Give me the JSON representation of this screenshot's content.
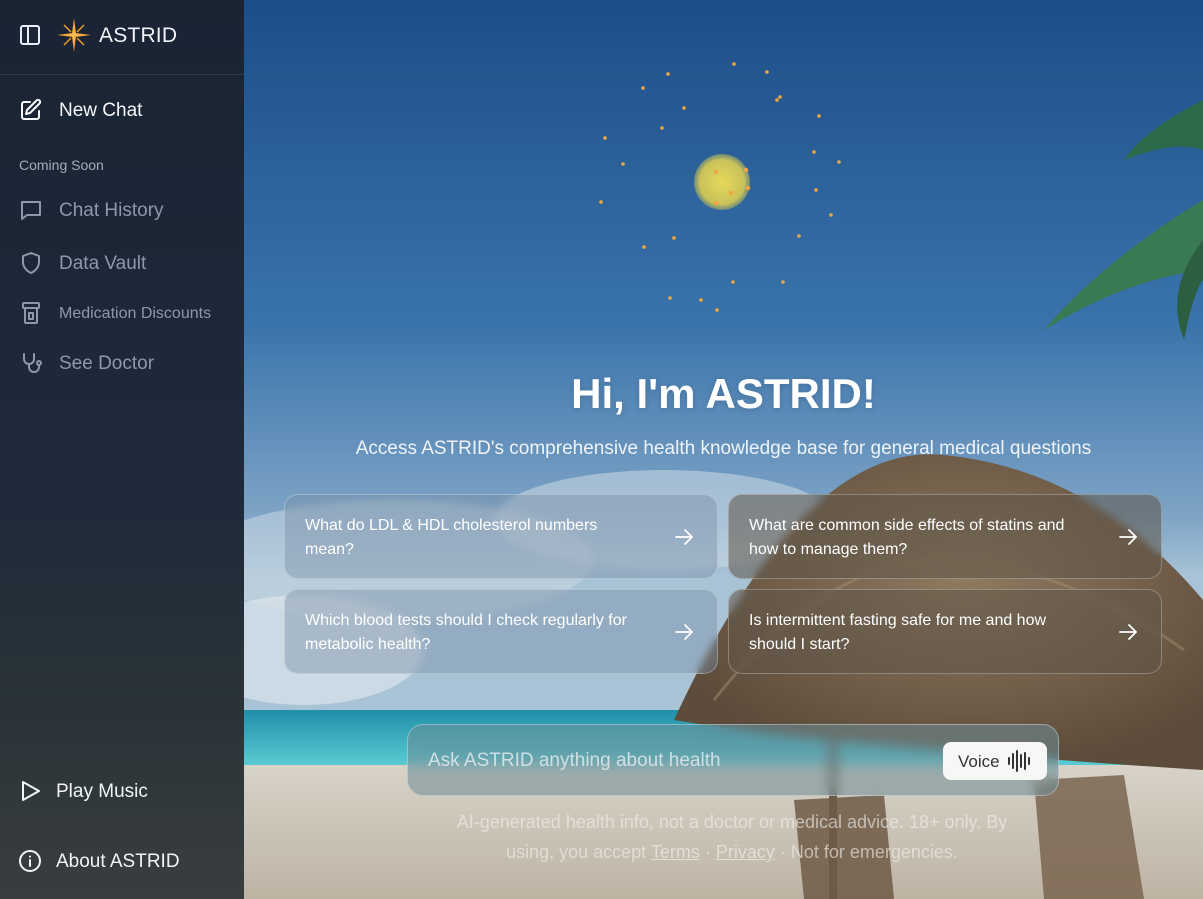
{
  "brand": {
    "name": "ASTRID"
  },
  "sidebar": {
    "new_chat": "New Chat",
    "coming_soon_heading": "Coming Soon",
    "coming_soon_items": [
      {
        "label": "Chat History",
        "icon": "chat-bubble-icon"
      },
      {
        "label": "Data Vault",
        "icon": "shield-icon"
      },
      {
        "label": "Medication Discounts",
        "icon": "pill-bottle-icon"
      },
      {
        "label": "See Doctor",
        "icon": "stethoscope-icon"
      }
    ],
    "bottom_items": [
      {
        "label": "Play Music",
        "icon": "play-icon"
      },
      {
        "label": "About ASTRID",
        "icon": "info-icon"
      }
    ]
  },
  "main": {
    "title": "Hi, I'm ASTRID!",
    "subtitle": "Access ASTRID's comprehensive health knowledge base for general medical questions",
    "suggestions": [
      "What do LDL & HDL cholesterol numbers mean?",
      "What are common side effects of statins and how to manage them?",
      "Which blood tests should I check regularly for metabolic health?",
      "Is intermittent fasting safe for me and how should I start?"
    ],
    "input": {
      "placeholder": "Ask ASTRID anything about health"
    },
    "voice_label": "Voice",
    "disclaimer": {
      "text_before": "AI-generated health info, not a doctor or medical advice. 18+ only. By using, you accept ",
      "terms": "Terms",
      "separator": " · ",
      "privacy": "Privacy",
      "text_after": " · Not for emergencies."
    }
  },
  "colors": {
    "sidebar_bg": "#1a2433",
    "logo_orange": "#f0a030",
    "sky_top": "#1e4f8a",
    "sea": "#2fb4c4",
    "sand": "#e9e2d6"
  }
}
